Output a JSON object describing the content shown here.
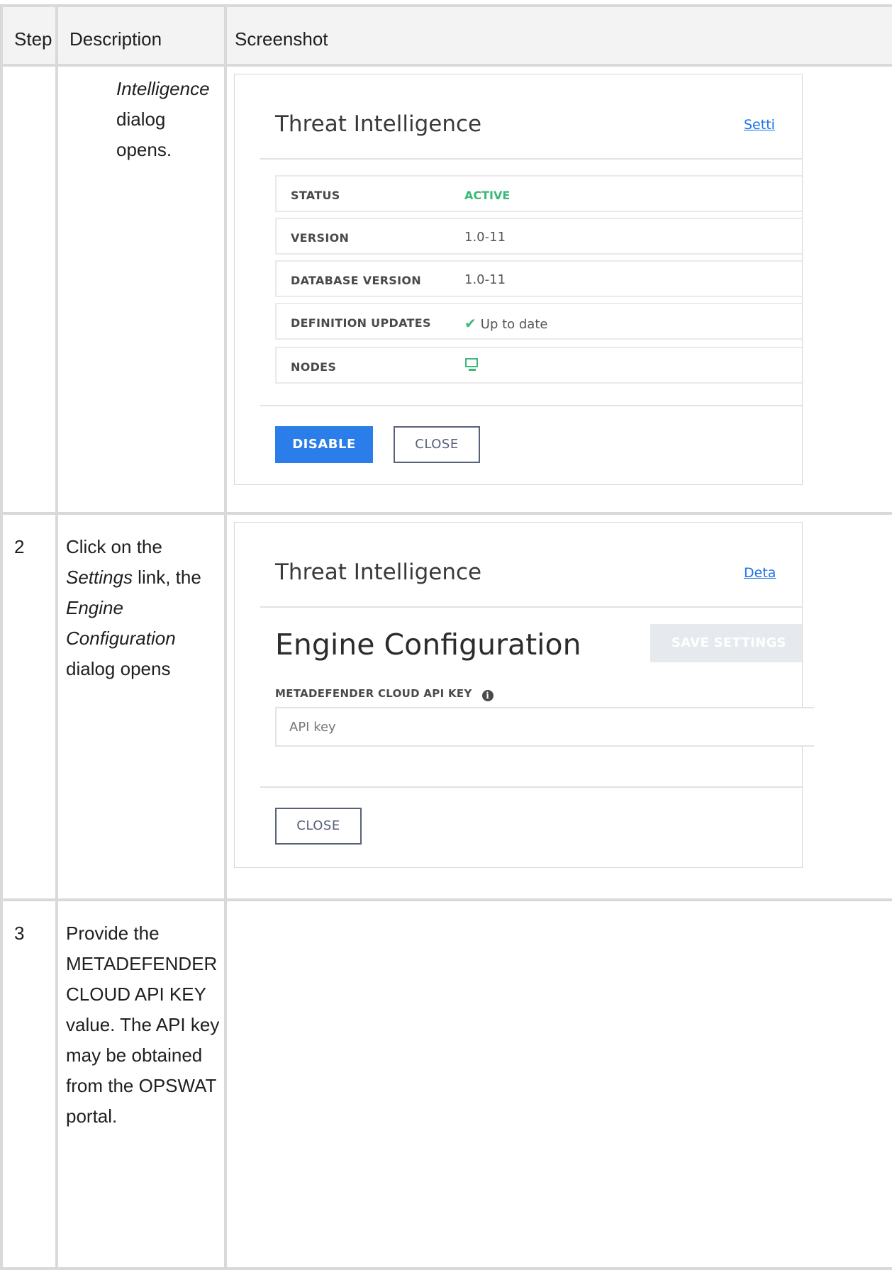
{
  "table": {
    "headers": {
      "step": "Step",
      "description": "Description",
      "screenshot": "Screenshot"
    },
    "rows": [
      {
        "step": "",
        "desc_parts": {
          "italic1": "Intelligence",
          "text1": "dialog",
          "text2": "opens."
        }
      },
      {
        "step": "2",
        "desc_parts": {
          "line1": "Click on the",
          "italic1": "Settings",
          "text1": " link, the",
          "italic2": "Engine",
          "italic3": "Configuration",
          "text2": "dialog opens"
        }
      },
      {
        "step": "3",
        "desc_lines": [
          "Provide the",
          "METADEFENDER",
          "CLOUD API KEY",
          "value. The API key",
          "may be obtained",
          "from the OPSWAT",
          "portal."
        ]
      }
    ]
  },
  "threat_dialog": {
    "title": "Threat Intelligence",
    "settings_link": "Setti",
    "rows": [
      {
        "key": "STATUS",
        "value": "ACTIVE"
      },
      {
        "key": "VERSION",
        "value": "1.0-11"
      },
      {
        "key": "DATABASE VERSION",
        "value": "1.0-11"
      },
      {
        "key": "DEFINITION UPDATES",
        "value": "Up to date"
      },
      {
        "key": "NODES",
        "value": ""
      }
    ],
    "disable_label": "DISABLE",
    "close_label": "CLOSE",
    "colors": {
      "active": "#3cb878",
      "primary": "#2b7de9"
    },
    "icons": {
      "check": "check-icon",
      "nodes": "monitor-icon"
    }
  },
  "engine_dialog": {
    "title": "Threat Intelligence",
    "details_link": "Deta",
    "heading": "Engine Configuration",
    "save_label": "SAVE SETTINGS",
    "field_label": "METADEFENDER CLOUD API KEY",
    "field_placeholder": "API key",
    "close_label": "CLOSE",
    "icons": {
      "field_info": "info-icon"
    }
  }
}
